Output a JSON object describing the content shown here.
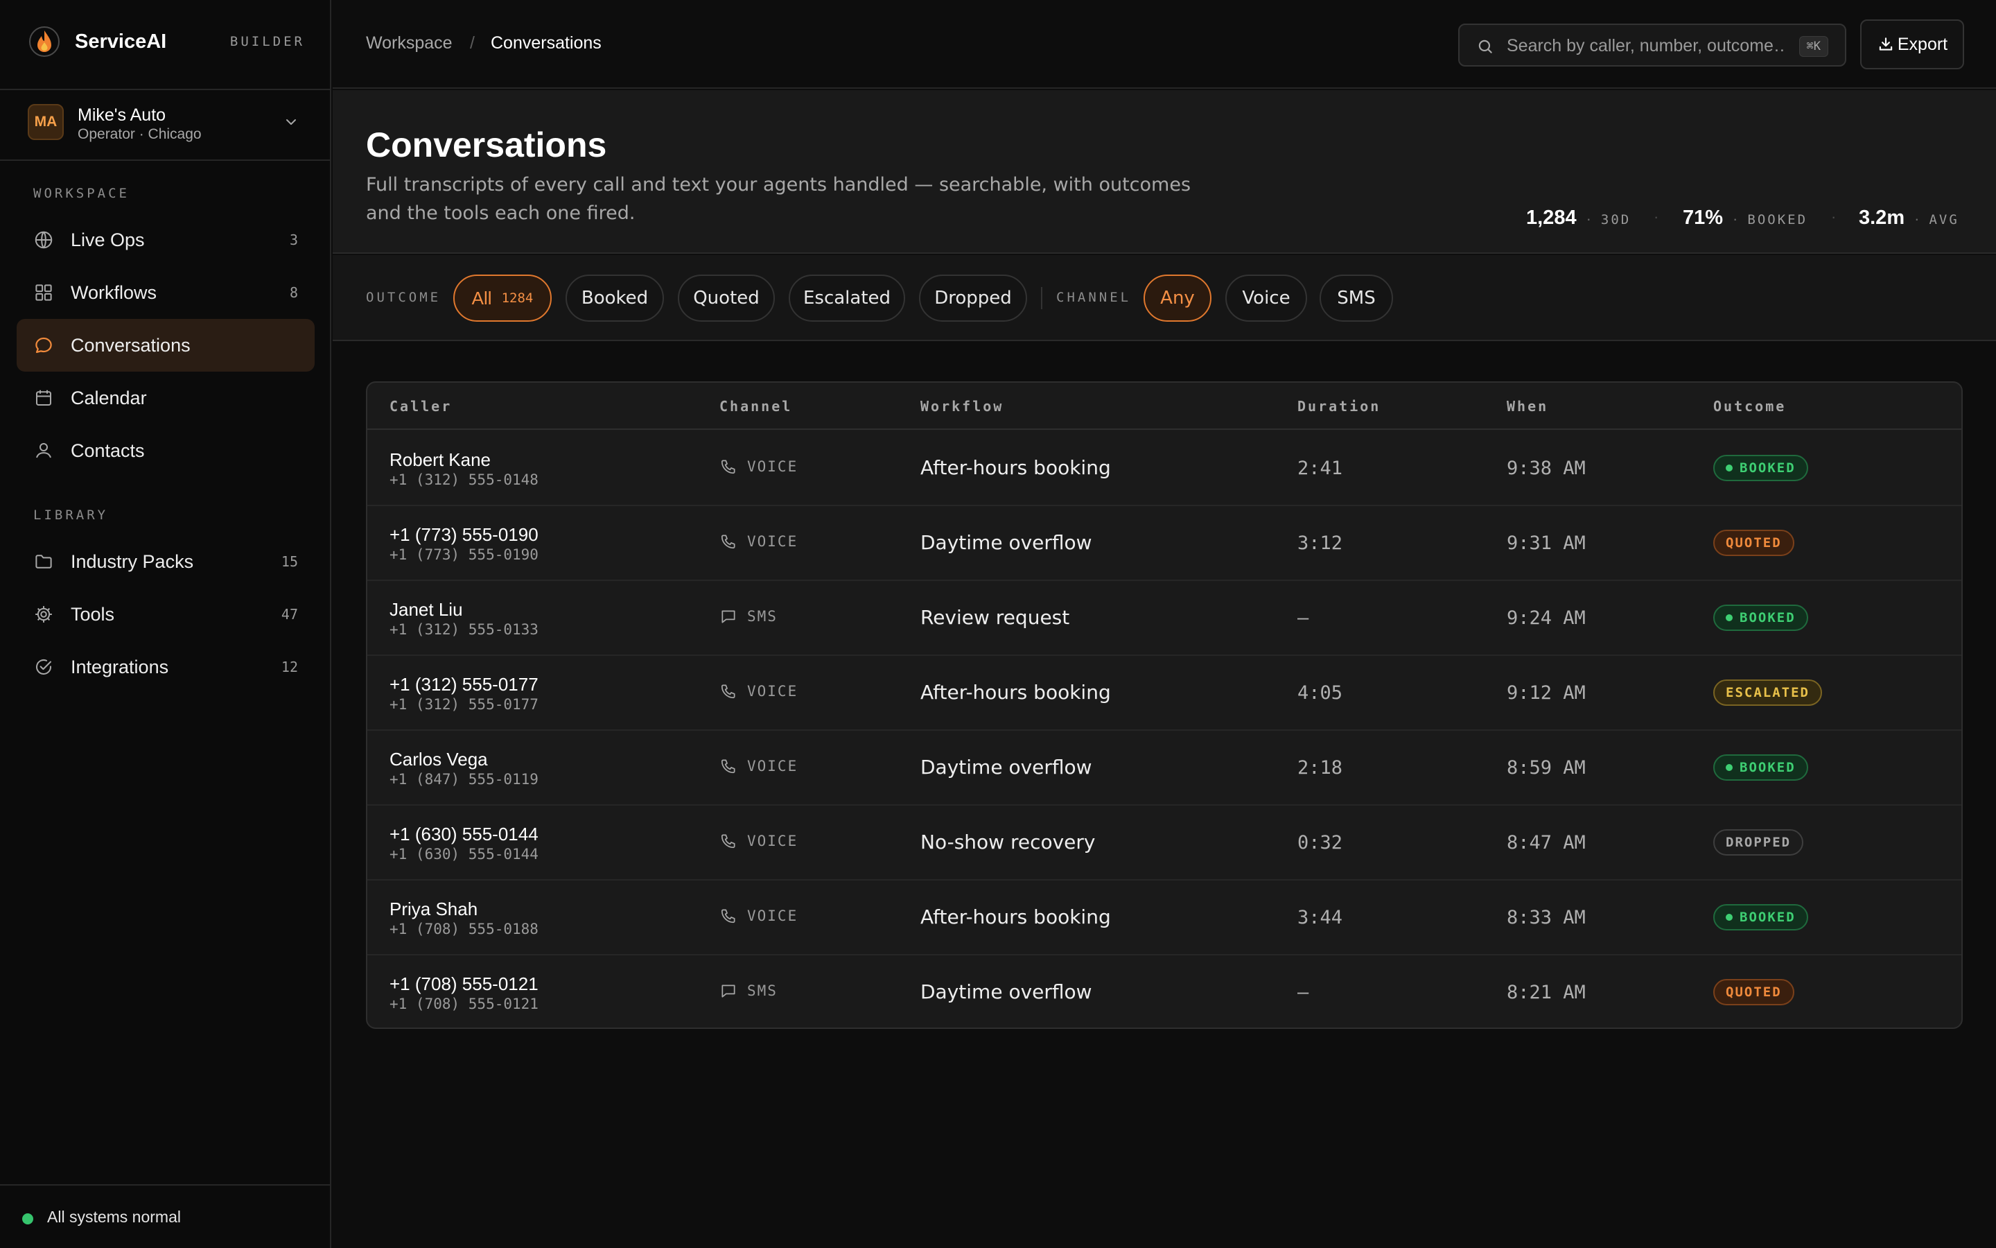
{
  "brand": {
    "name": "ServiceAI",
    "tag": "BUILDER"
  },
  "org": {
    "initials": "MA",
    "name": "Mike's Auto",
    "sub": "Operator · Chicago"
  },
  "sidebar": {
    "workspace_label": "WORKSPACE",
    "workspace_items": [
      {
        "label": "Live Ops",
        "count": "3",
        "icon": "globe-icon"
      },
      {
        "label": "Workflows",
        "count": "8",
        "icon": "grid-icon"
      },
      {
        "label": "Conversations",
        "count": "",
        "icon": "chat-bubble-icon",
        "active": true
      },
      {
        "label": "Calendar",
        "count": "",
        "icon": "calendar-icon"
      },
      {
        "label": "Contacts",
        "count": "",
        "icon": "user-icon"
      }
    ],
    "library_label": "LIBRARY",
    "library_items": [
      {
        "label": "Industry Packs",
        "count": "15",
        "icon": "folder-icon"
      },
      {
        "label": "Tools",
        "count": "47",
        "icon": "gear-icon"
      },
      {
        "label": "Integrations",
        "count": "12",
        "icon": "check-circle-icon"
      }
    ],
    "status": "All systems normal"
  },
  "topbar": {
    "crumb_1": "Workspace",
    "crumb_sep": "/",
    "crumb_2": "Conversations",
    "search_placeholder": "Search by caller, number, outcome…",
    "search_kbd": "⌘K",
    "export_label": "Export"
  },
  "header": {
    "title": "Conversations",
    "description": "Full transcripts of every call and text your agents handled — searchable, with outcomes and the tools each one fired.",
    "stats": [
      {
        "value": "1,284",
        "label": "30D"
      },
      {
        "value": "71%",
        "label": "BOOKED"
      },
      {
        "value": "3.2m",
        "label": "AVG"
      }
    ]
  },
  "filters": {
    "outcome_label": "OUTCOME",
    "outcome_all": "All",
    "outcome_all_count": "1284",
    "outcome_options": [
      "Booked",
      "Quoted",
      "Escalated",
      "Dropped"
    ],
    "channel_label": "CHANNEL",
    "channel_options": [
      "Any",
      "Voice",
      "SMS"
    ]
  },
  "table": {
    "columns": [
      "Caller",
      "Channel",
      "Workflow",
      "Duration",
      "When",
      "Outcome"
    ],
    "rows": [
      {
        "name": "Robert Kane",
        "phone": "+1 (312) 555-0148",
        "channel": "VOICE",
        "workflow": "After-hours booking",
        "duration": "2:41",
        "when": "9:38 AM",
        "outcome": "BOOKED"
      },
      {
        "name": "+1 (773) 555-0190",
        "phone": "+1 (773) 555-0190",
        "channel": "VOICE",
        "workflow": "Daytime overflow",
        "duration": "3:12",
        "when": "9:31 AM",
        "outcome": "QUOTED"
      },
      {
        "name": "Janet Liu",
        "phone": "+1 (312) 555-0133",
        "channel": "SMS",
        "workflow": "Review request",
        "duration": "—",
        "when": "9:24 AM",
        "outcome": "BOOKED"
      },
      {
        "name": "+1 (312) 555-0177",
        "phone": "+1 (312) 555-0177",
        "channel": "VOICE",
        "workflow": "After-hours booking",
        "duration": "4:05",
        "when": "9:12 AM",
        "outcome": "ESCALATED"
      },
      {
        "name": "Carlos Vega",
        "phone": "+1 (847) 555-0119",
        "channel": "VOICE",
        "workflow": "Daytime overflow",
        "duration": "2:18",
        "when": "8:59 AM",
        "outcome": "BOOKED"
      },
      {
        "name": "+1 (630) 555-0144",
        "phone": "+1 (630) 555-0144",
        "channel": "VOICE",
        "workflow": "No-show recovery",
        "duration": "0:32",
        "when": "8:47 AM",
        "outcome": "DROPPED"
      },
      {
        "name": "Priya Shah",
        "phone": "+1 (708) 555-0188",
        "channel": "VOICE",
        "workflow": "After-hours booking",
        "duration": "3:44",
        "when": "8:33 AM",
        "outcome": "BOOKED"
      },
      {
        "name": "+1 (708) 555-0121",
        "phone": "+1 (708) 555-0121",
        "channel": "SMS",
        "workflow": "Daytime overflow",
        "duration": "—",
        "when": "8:21 AM",
        "outcome": "QUOTED"
      }
    ]
  },
  "colors": {
    "accent": "#f59045",
    "booked": "#3ecf73",
    "quoted": "#f08a3c",
    "escalated": "#e8c04a",
    "dropped": "#a8a8a8"
  }
}
